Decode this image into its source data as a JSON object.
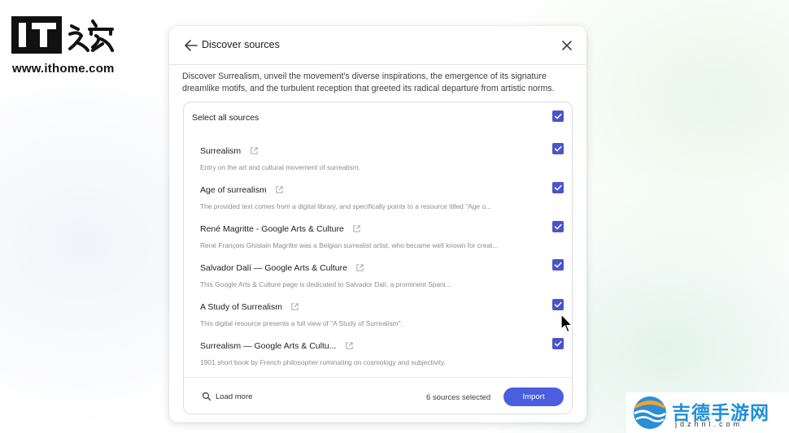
{
  "watermark": {
    "site_logo_text": "IT之家",
    "site_url": "www.ithome.com",
    "corner_title": "吉德手游网",
    "corner_url": "jdzhnl.com"
  },
  "dialog": {
    "title": "Discover sources",
    "back_icon": "arrow-back-icon",
    "close_icon": "close-icon",
    "description": "Discover Surrealism, unveil the movement's diverse inspirations, the emergence of its signature dreamlike motifs, and the turbulent reception that greeted its radical departure from artistic norms.",
    "select_all_label": "Select all sources",
    "select_all_checked": true,
    "sources": [
      {
        "title": "Surrealism",
        "description": "Entry on the art and cultural movement of surrealism.",
        "checked": true
      },
      {
        "title": "Age of surrealism",
        "description": "The provided text comes from a digital library, and specifically points to a resource titled \"Age o...",
        "checked": true
      },
      {
        "title": "René Magritte - Google Arts & Culture",
        "description": "René François Ghislain Magritte was a Belgian surrealist artist, who became well known for creat...",
        "checked": true
      },
      {
        "title": "Salvador Dalí — Google Arts & Culture",
        "description": "This Google Arts & Culture page is dedicated to Salvador Dalí, a prominent Spani...",
        "checked": true
      },
      {
        "title": "A Study of Surrealism",
        "description": "This digital resource presents a full view of \"A Study of Surrealism\".",
        "checked": true
      },
      {
        "title": "Surrealism — Google Arts & Cultu...",
        "description": "1901 short book by French philosopher ruminating on cosmology and subjectivity.",
        "checked": true
      }
    ],
    "footer": {
      "load_more_label": "Load more",
      "selected_count": "6 sources selected",
      "import_label": "Import"
    }
  },
  "colors": {
    "checkbox": "#4a55c8",
    "import_button": "#4b5ee0",
    "corner_brand": "#1f8fd8"
  }
}
